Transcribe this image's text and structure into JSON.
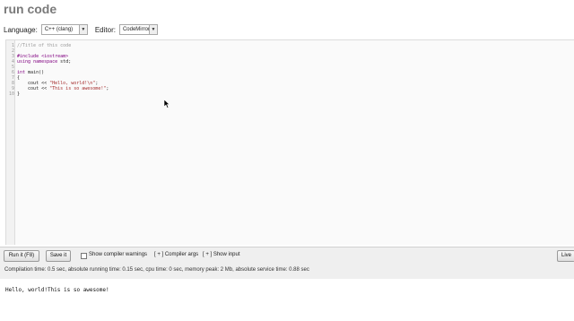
{
  "app": {
    "title": "run code"
  },
  "toolbar": {
    "language_label": "Language:",
    "language_value": "C++ (clang)",
    "editor_label": "Editor:",
    "editor_value": "CodeMirror"
  },
  "editor": {
    "lines": [
      {
        "num": "1",
        "segments": [
          {
            "t": "//Title of this code",
            "k": "comment"
          }
        ]
      },
      {
        "num": "2",
        "segments": []
      },
      {
        "num": "3",
        "segments": [
          {
            "t": "#include <iostream>",
            "k": "kw"
          }
        ]
      },
      {
        "num": "4",
        "segments": [
          {
            "t": "using ",
            "k": "kw"
          },
          {
            "t": "namespace ",
            "k": "kw"
          },
          {
            "t": "std;",
            "k": "plain"
          }
        ]
      },
      {
        "num": "5",
        "segments": []
      },
      {
        "num": "6",
        "segments": [
          {
            "t": "int ",
            "k": "kw"
          },
          {
            "t": "main()",
            "k": "plain"
          }
        ]
      },
      {
        "num": "7",
        "segments": [
          {
            "t": "{",
            "k": "plain"
          }
        ]
      },
      {
        "num": "8",
        "segments": [
          {
            "t": "    cout << ",
            "k": "plain"
          },
          {
            "t": "\"Hello, world!\\n\"",
            "k": "str"
          },
          {
            "t": ";",
            "k": "plain"
          }
        ]
      },
      {
        "num": "9",
        "segments": [
          {
            "t": "    cout << ",
            "k": "plain"
          },
          {
            "t": "\"This is so awesome!\"",
            "k": "str"
          },
          {
            "t": ";",
            "k": "plain"
          }
        ]
      },
      {
        "num": "10",
        "segments": [
          {
            "t": "}",
            "k": "plain"
          }
        ]
      }
    ]
  },
  "actions": {
    "run_label": "Run it (F8)",
    "save_label": "Save it",
    "warnings_label": "Show compiler warnings",
    "compiler_args_label": "[ + ] Compiler args",
    "show_input_label": "[ + ] Show input",
    "live_label": "Live"
  },
  "stats": {
    "text": "Compilation time: 0.5 sec, absolute running time: 0.15 sec, cpu time: 0 sec, memory peak: 2 Mb, absolute service time: 0.88 sec"
  },
  "output": {
    "text": "Hello, world!This is so awesome!"
  },
  "colors": {
    "comment": "#999999",
    "keyword": "#800080",
    "string": "#a52a2a"
  }
}
